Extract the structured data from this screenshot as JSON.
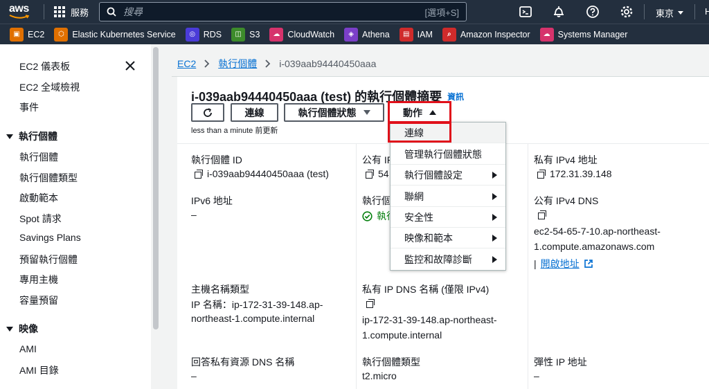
{
  "topnav": {
    "logo_text": "aws",
    "services_label": "服務",
    "search_placeholder": "搜尋",
    "search_shortcut": "[選項+S]",
    "region": "東京",
    "account_initial": "H"
  },
  "favorites": [
    {
      "label": "EC2",
      "icon": "ec2-icon",
      "color": "#e07000"
    },
    {
      "label": "Elastic Kubernetes Service",
      "icon": "eks-icon",
      "color": "#e07000"
    },
    {
      "label": "RDS",
      "icon": "rds-icon",
      "color": "#4a3bd8"
    },
    {
      "label": "S3",
      "icon": "s3-icon",
      "color": "#3d8b2b"
    },
    {
      "label": "CloudWatch",
      "icon": "cloudwatch-icon",
      "color": "#d6336c"
    },
    {
      "label": "Athena",
      "icon": "athena-icon",
      "color": "#7b3fc8"
    },
    {
      "label": "IAM",
      "icon": "iam-icon",
      "color": "#cf2b2b"
    },
    {
      "label": "Amazon Inspector",
      "icon": "inspector-icon",
      "color": "#cf2b2b"
    },
    {
      "label": "Systems Manager",
      "icon": "systems-manager-icon",
      "color": "#d6336c"
    }
  ],
  "sidebar": {
    "top_items": [
      "EC2 儀表板",
      "EC2 全域檢視",
      "事件"
    ],
    "section_instances": {
      "title": "執行個體",
      "items": [
        "執行個體",
        "執行個體類型",
        "啟動範本",
        "Spot 請求",
        "Savings Plans",
        "預留執行個體",
        "專用主機",
        "容量預留"
      ]
    },
    "section_images": {
      "title": "映像",
      "items": [
        "AMI",
        "AMI 目錄"
      ]
    }
  },
  "breadcrumb": {
    "root": "EC2",
    "parent": "執行個體",
    "current": "i-039aab94440450aaa"
  },
  "summary": {
    "title": "i-039aab94440450aaa (test) 的執行個體摘要",
    "info_link": "資訊",
    "connect_btn": "連線",
    "state_btn": "執行個體狀態",
    "actions_btn": "動作",
    "updated": "less than a minute 前更新"
  },
  "details": {
    "instance_id_label": "執行個體 ID",
    "instance_id_value": "i-039aab94440450aaa (test)",
    "public_ip_label": "公有 IP",
    "public_ip_value": "54",
    "private_ipv4_label": "私有 IPv4 地址",
    "private_ipv4_value": "172.31.39.148",
    "ipv6_label": "IPv6 地址",
    "ipv6_value": "–",
    "state_label": "執行個",
    "state_value": "執行",
    "public_dns_label": "公有 IPv4 DNS",
    "public_dns_value_1": "ec2-54-65-7-10.ap-northeast-",
    "public_dns_value_2": "1.compute.amazonaws.com",
    "open_address": "開啟地址",
    "hostname_type_label": "主機名稱類型",
    "hostname_type_value_1": "IP 名稱：ip-172-31-39-148.ap-",
    "hostname_type_value_2": "northeast-1.compute.internal",
    "private_dns_label": "私有 IP DNS 名稱 (僅限 IPv4)",
    "private_dns_value_1": "ip-172-31-39-148.ap-northeast-",
    "private_dns_value_2": "1.compute.internal",
    "answer_dns_label": "回答私有資源 DNS 名稱",
    "answer_dns_value": "–",
    "instance_type_label": "執行個體類型",
    "instance_type_value": "t2.micro",
    "elastic_ip_label": "彈性 IP 地址",
    "elastic_ip_value": "–"
  },
  "actions_menu": {
    "items": [
      "連線",
      "管理執行個體狀態",
      "執行個體設定",
      "聯網",
      "安全性",
      "映像和範本",
      "監控和故障診斷"
    ]
  }
}
